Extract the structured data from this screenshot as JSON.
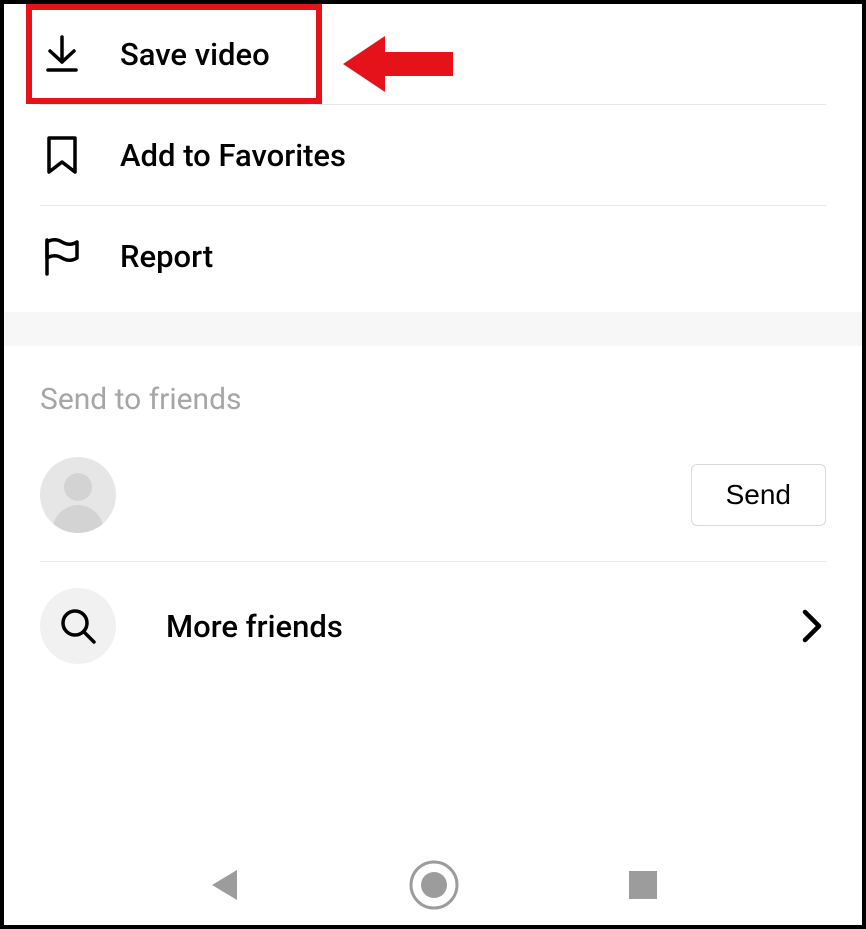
{
  "menu": {
    "save_video": "Save video",
    "add_favorites": "Add to Favorites",
    "report": "Report"
  },
  "friends": {
    "header": "Send to friends",
    "send_button": "Send",
    "more_friends": "More friends"
  },
  "colors": {
    "highlight": "#e6121a"
  }
}
